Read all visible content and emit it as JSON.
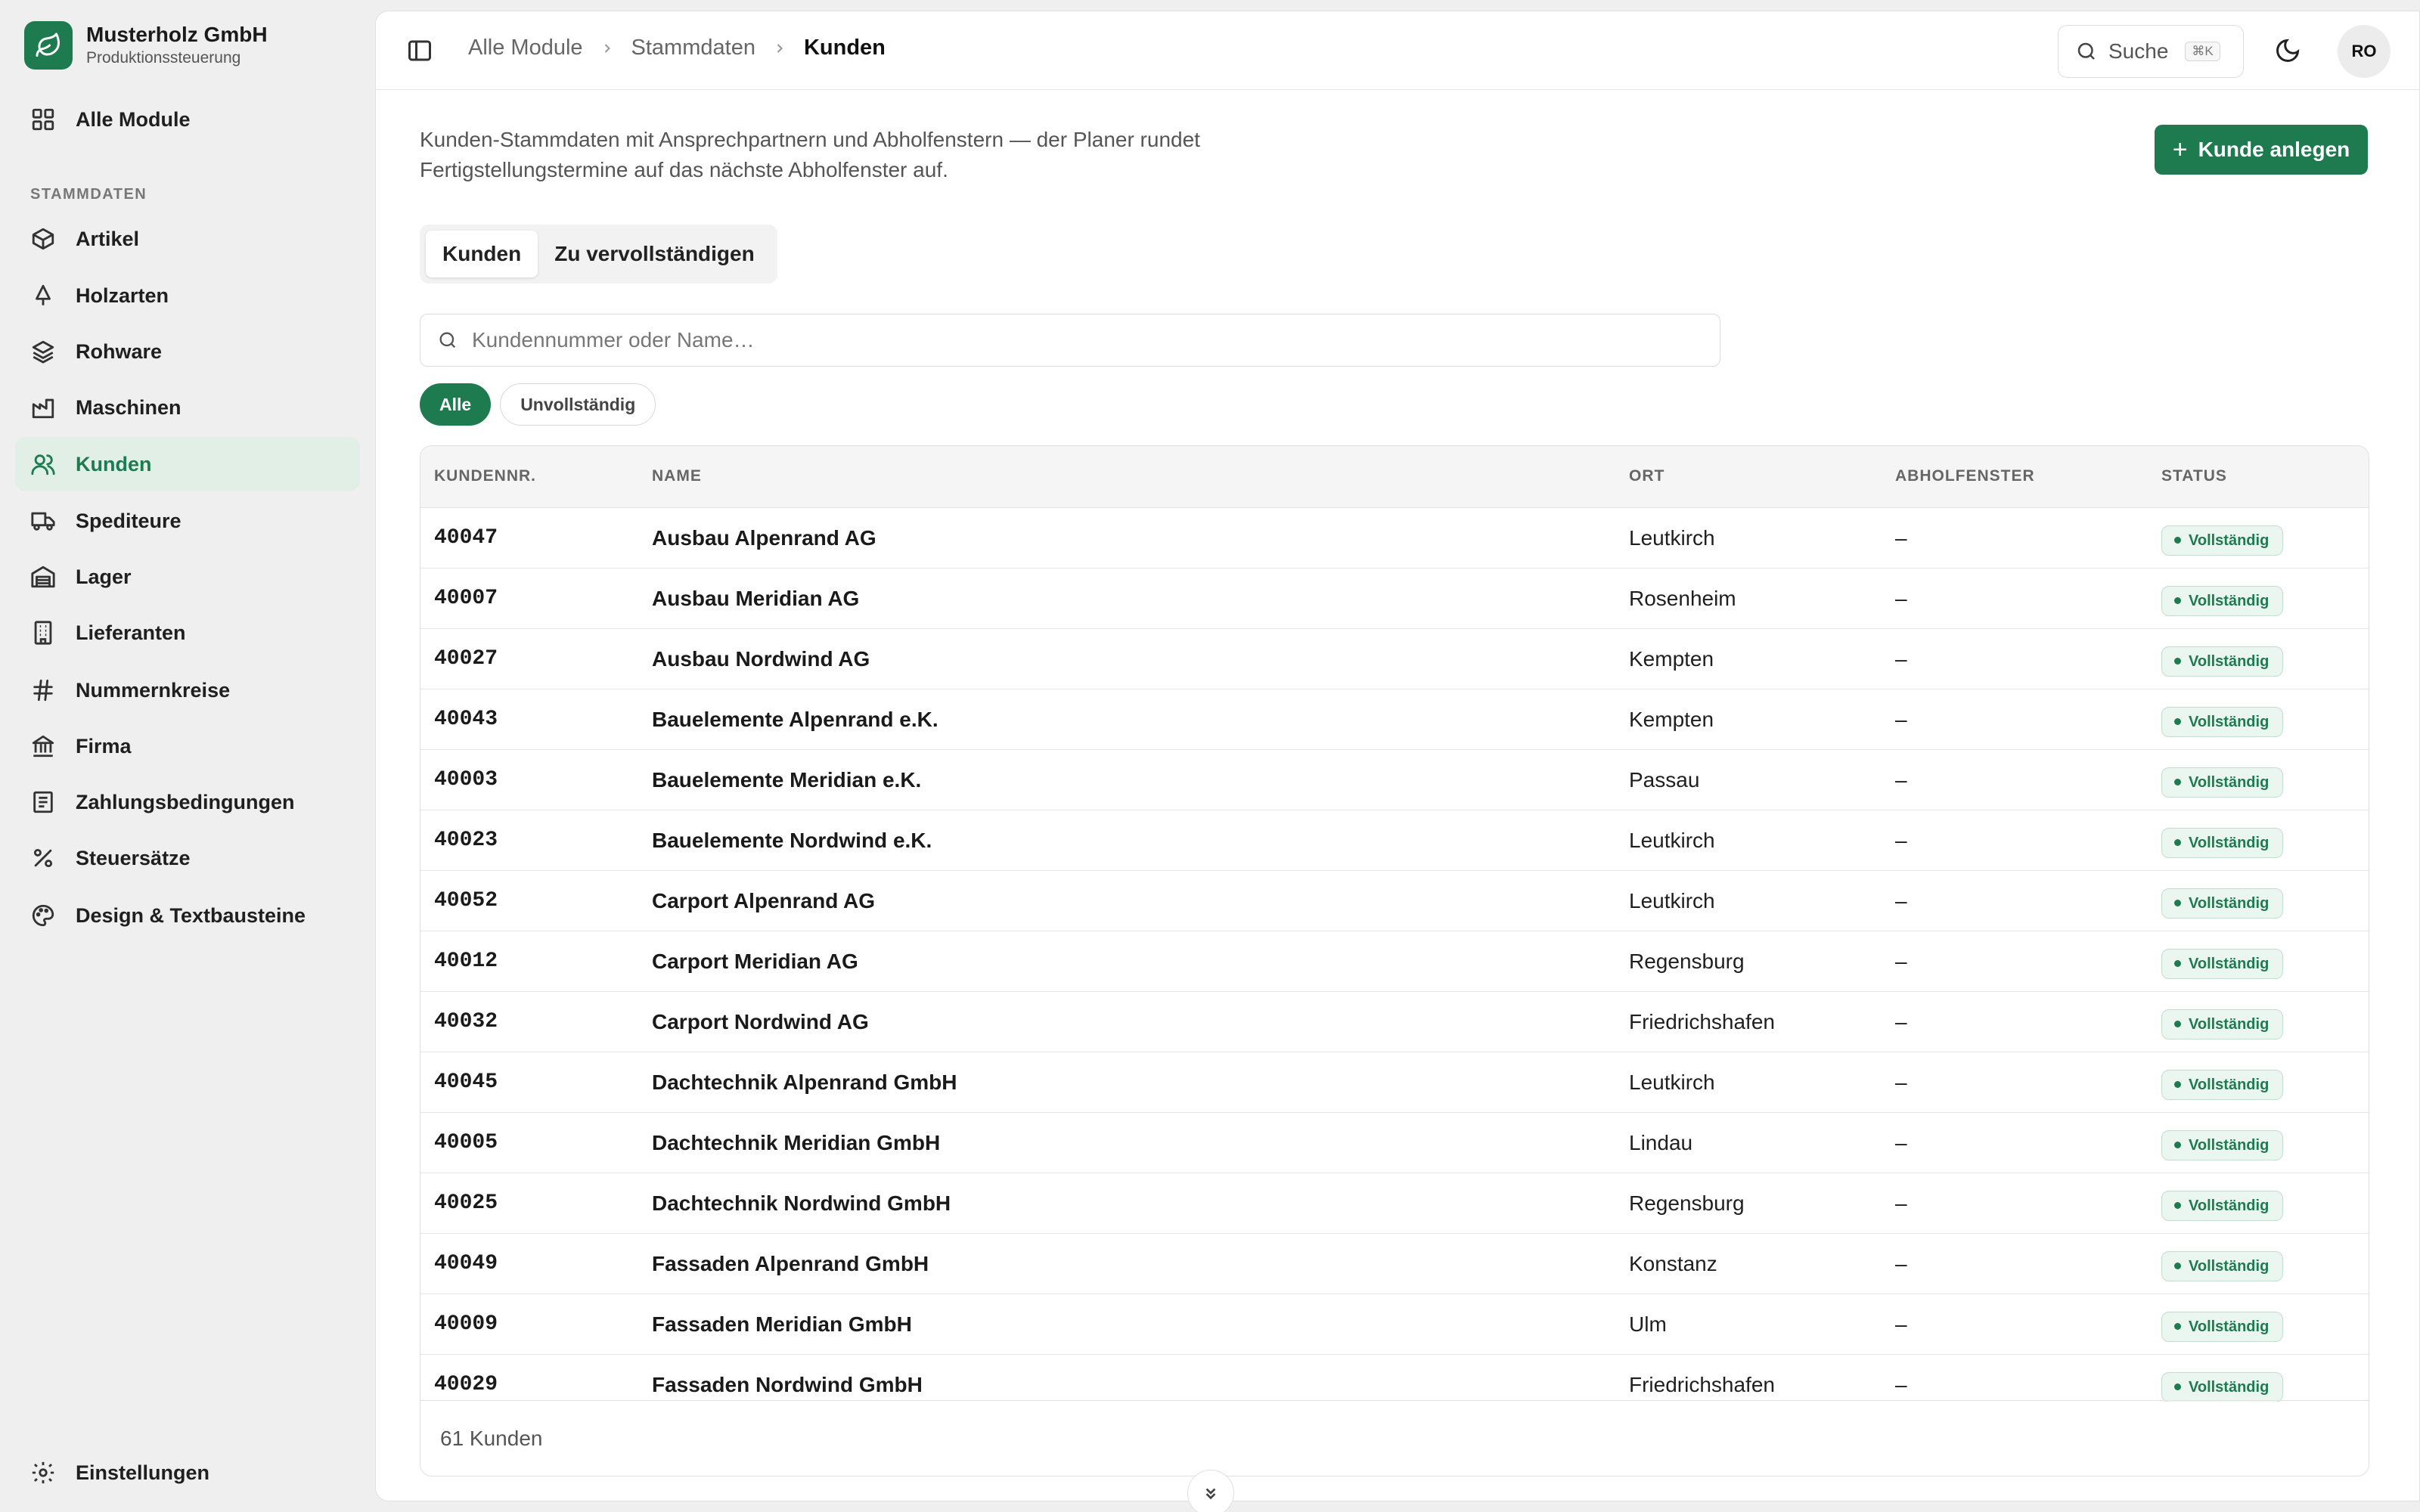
{
  "brand": {
    "name": "Musterholz GmbH",
    "subtitle": "Produktionssteuerung"
  },
  "sidebar": {
    "all_modules": "Alle Module",
    "section_label": "STAMMDATEN",
    "items": [
      {
        "label": "Artikel",
        "icon": "box-icon"
      },
      {
        "label": "Holzarten",
        "icon": "tree-icon"
      },
      {
        "label": "Rohware",
        "icon": "layers-icon"
      },
      {
        "label": "Maschinen",
        "icon": "factory-icon"
      },
      {
        "label": "Kunden",
        "icon": "users-icon",
        "active": true
      },
      {
        "label": "Spediteure",
        "icon": "truck-icon"
      },
      {
        "label": "Lager",
        "icon": "warehouse-icon"
      },
      {
        "label": "Lieferanten",
        "icon": "building-icon"
      },
      {
        "label": "Nummernkreise",
        "icon": "hash-icon"
      },
      {
        "label": "Firma",
        "icon": "bank-icon"
      },
      {
        "label": "Zahlungsbedingungen",
        "icon": "receipt-icon"
      },
      {
        "label": "Steuersätze",
        "icon": "percent-icon"
      },
      {
        "label": "Design & Textbausteine",
        "icon": "palette-icon"
      }
    ],
    "settings": "Einstellungen"
  },
  "topbar": {
    "breadcrumb": [
      "Alle Module",
      "Stammdaten",
      "Kunden"
    ],
    "search_label": "Suche",
    "search_shortcut": "⌘K",
    "avatar_initials": "RO"
  },
  "main": {
    "intro": "Kunden-Stammdaten mit Ansprechpartnern und Abholfenstern — der Planer rundet Fertigstellungstermine auf das nächste Abholfenster auf.",
    "add_button": "Kunde anlegen",
    "tabs": [
      "Kunden",
      "Zu vervollständigen"
    ],
    "filter_placeholder": "Kundennummer oder Name…",
    "chips": [
      "Alle",
      "Unvollständig"
    ],
    "table": {
      "headers": [
        "KUNDENNR.",
        "NAME",
        "ORT",
        "ABHOLFENSTER",
        "STATUS"
      ],
      "rows": [
        {
          "nr": "40047",
          "name": "Ausbau Alpenrand AG",
          "ort": "Leutkirch",
          "abholfenster": "–",
          "status": "Vollständig"
        },
        {
          "nr": "40007",
          "name": "Ausbau Meridian AG",
          "ort": "Rosenheim",
          "abholfenster": "–",
          "status": "Vollständig"
        },
        {
          "nr": "40027",
          "name": "Ausbau Nordwind AG",
          "ort": "Kempten",
          "abholfenster": "–",
          "status": "Vollständig"
        },
        {
          "nr": "40043",
          "name": "Bauelemente Alpenrand e.K.",
          "ort": "Kempten",
          "abholfenster": "–",
          "status": "Vollständig"
        },
        {
          "nr": "40003",
          "name": "Bauelemente Meridian e.K.",
          "ort": "Passau",
          "abholfenster": "–",
          "status": "Vollständig"
        },
        {
          "nr": "40023",
          "name": "Bauelemente Nordwind e.K.",
          "ort": "Leutkirch",
          "abholfenster": "–",
          "status": "Vollständig"
        },
        {
          "nr": "40052",
          "name": "Carport Alpenrand AG",
          "ort": "Leutkirch",
          "abholfenster": "–",
          "status": "Vollständig"
        },
        {
          "nr": "40012",
          "name": "Carport Meridian AG",
          "ort": "Regensburg",
          "abholfenster": "–",
          "status": "Vollständig"
        },
        {
          "nr": "40032",
          "name": "Carport Nordwind AG",
          "ort": "Friedrichshafen",
          "abholfenster": "–",
          "status": "Vollständig"
        },
        {
          "nr": "40045",
          "name": "Dachtechnik Alpenrand GmbH",
          "ort": "Leutkirch",
          "abholfenster": "–",
          "status": "Vollständig"
        },
        {
          "nr": "40005",
          "name": "Dachtechnik Meridian GmbH",
          "ort": "Lindau",
          "abholfenster": "–",
          "status": "Vollständig"
        },
        {
          "nr": "40025",
          "name": "Dachtechnik Nordwind GmbH",
          "ort": "Regensburg",
          "abholfenster": "–",
          "status": "Vollständig"
        },
        {
          "nr": "40049",
          "name": "Fassaden Alpenrand GmbH",
          "ort": "Konstanz",
          "abholfenster": "–",
          "status": "Vollständig"
        },
        {
          "nr": "40009",
          "name": "Fassaden Meridian GmbH",
          "ort": "Ulm",
          "abholfenster": "–",
          "status": "Vollständig"
        },
        {
          "nr": "40029",
          "name": "Fassaden Nordwind GmbH",
          "ort": "Friedrichshafen",
          "abholfenster": "–",
          "status": "Vollständig"
        }
      ],
      "footer": "61 Kunden"
    }
  },
  "colors": {
    "accent": "#1e7a4f",
    "accent_soft": "#e1efe6",
    "background": "#efefef"
  }
}
